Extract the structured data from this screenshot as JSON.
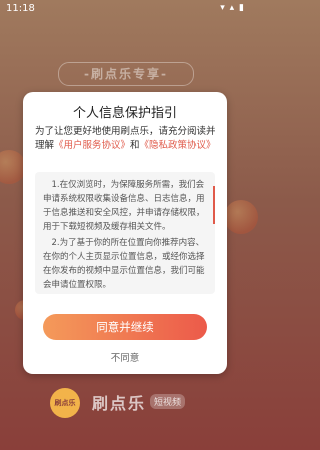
{
  "status_bar": {
    "time": "11:18",
    "icons": "▾ ▴ ▮"
  },
  "background": {
    "banner": "-刷点乐专享-",
    "logo_badge": "刷点乐",
    "logo_text": "刷点乐",
    "logo_tag": "短视频"
  },
  "dialog": {
    "title": "个人信息保护指引",
    "intro_prefix": "为了让您更好地使用刷点乐，请充分阅读并理解",
    "user_agreement_link": "《用户服务协议》",
    "intro_and": "和",
    "privacy_policy_link": "《隐私政策协议》",
    "policy_paragraph_1": "1.在仅浏览时，为保障服务所需，我们会申请系统权限收集设备信息、日志信息，用于信息推送和安全风控，并申请存储权限，用于下载短视频及缓存相关文件。",
    "policy_paragraph_2": "2.为了基于你的所在位置向你推荐内容、在你的个人主页显示位置信息，或经你选择在你发布的视频中显示位置信息，我们可能会申请位置权限。",
    "agree_button": "同意并继续",
    "disagree_button": "不同意"
  },
  "colors": {
    "accent": "#e05a4a",
    "button_gradient_start": "#f49a5a",
    "button_gradient_end": "#ec5a4a"
  }
}
